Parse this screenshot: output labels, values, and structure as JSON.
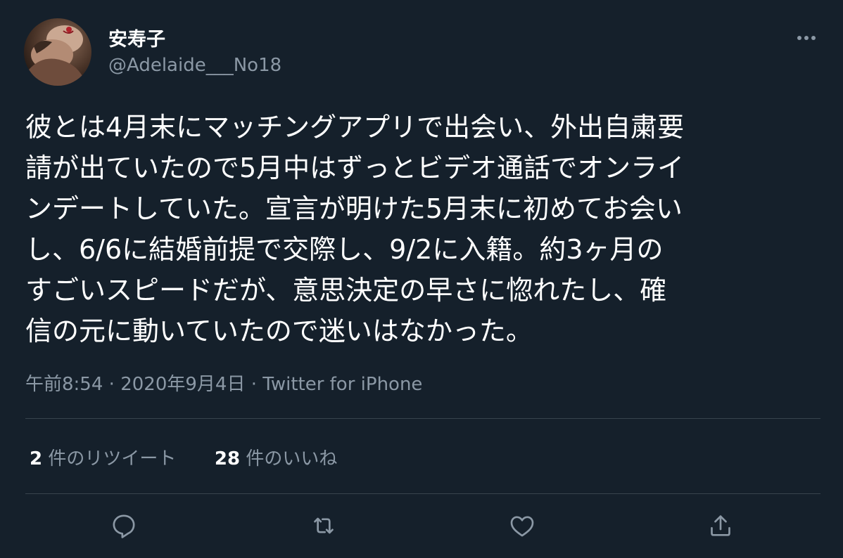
{
  "user": {
    "display_name": "安寿子",
    "handle": "@Adelaide___No18",
    "avatar_icon": "avatar-photo"
  },
  "tweet": {
    "lines": [
      "彼とは4月末にマッチングアプリで出会い、外出自粛要",
      "請が出ていたので5月中はずっとビデオ通話でオンライ",
      "ンデートしていた。宣言が明けた5月末に初めてお会い",
      "し、6/6に結婚前提で交際し、9/2に入籍。約3ヶ月の",
      "すごいスピードだが、意思決定の早さに惚れたし、確",
      "信の元に動いていたので迷いはなかった。"
    ],
    "time": "午前8:54",
    "separator": "·",
    "date": "2020年9月4日",
    "source": "Twitter for iPhone"
  },
  "stats": {
    "retweets_count": "2",
    "retweets_label": "件のリツイート",
    "likes_count": "28",
    "likes_label": "件のいいね"
  },
  "icons": {
    "more": "more-icon",
    "reply": "reply-icon",
    "retweet": "retweet-icon",
    "like": "like-icon",
    "share": "share-icon"
  },
  "colors": {
    "background": "#15202b",
    "text_primary": "#ffffff",
    "text_secondary": "#8b98a5",
    "divider": "#38444d",
    "icon": "#8b98a5"
  }
}
